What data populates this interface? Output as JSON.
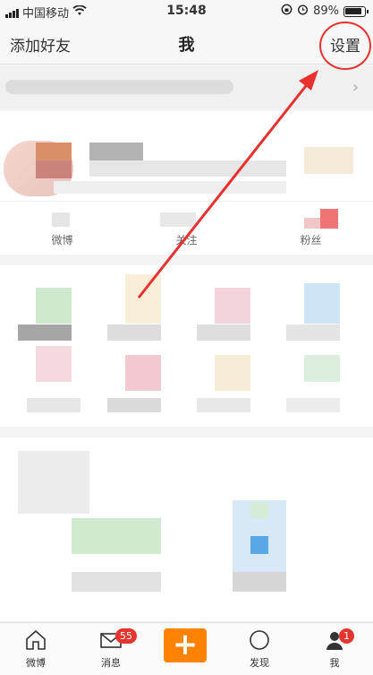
{
  "status_bar": {
    "carrier": "中国移动",
    "time": "15:48",
    "battery": "89%",
    "wifi_icon": "wifi-icon",
    "lock_icon": "orientation-lock-icon",
    "alarm_icon": "alarm-icon"
  },
  "nav": {
    "left_label": "添加好友",
    "title": "我",
    "right_label": "设置"
  },
  "stats": [
    {
      "label": "微博"
    },
    {
      "label": "关注"
    },
    {
      "label": "粉丝"
    }
  ],
  "tabs": [
    {
      "label": "微博",
      "icon": "home-icon"
    },
    {
      "label": "消息",
      "icon": "mail-icon",
      "badge": "55"
    },
    {
      "label": "+",
      "icon": "compose-plus-icon"
    },
    {
      "label": "发现",
      "icon": "discover-icon"
    },
    {
      "label": "我",
      "icon": "profile-icon",
      "badge": "1"
    }
  ],
  "colors": {
    "accent": "#ff8200",
    "badge": "#e5352f",
    "annotation": "#e8312f"
  }
}
